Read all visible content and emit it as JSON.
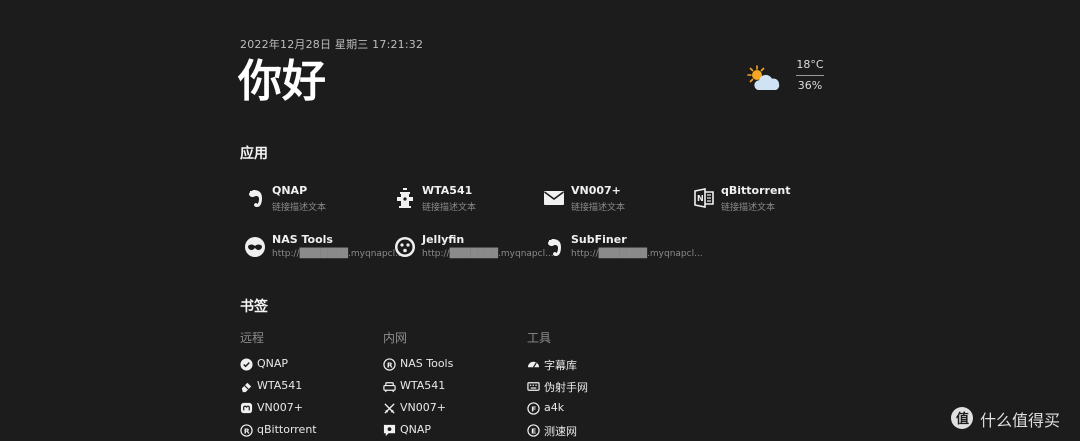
{
  "header": {
    "datetime": "2022年12月28日 星期三 17:21:32",
    "greeting": "你好"
  },
  "weather": {
    "icon": "partly-cloudy-icon",
    "temperature": "18°C",
    "humidity": "36%"
  },
  "apps": {
    "title": "应用",
    "items": [
      {
        "name": "QNAP",
        "desc": "链接描述文本",
        "icon": "evernote-icon"
      },
      {
        "name": "WTA541",
        "desc": "链接描述文本",
        "icon": "fire-hydrant-icon"
      },
      {
        "name": "VN007+",
        "desc": "链接描述文本",
        "icon": "mail-icon"
      },
      {
        "name": "qBittorrent",
        "desc": "链接描述文本",
        "icon": "office-icon"
      },
      {
        "name": "NAS Tools",
        "desc": "http://███████.myqnapcl...",
        "icon": "mask-icon"
      },
      {
        "name": "Jellyfin",
        "desc": "http://███████.myqnapcl...",
        "icon": "face-icon"
      },
      {
        "name": "SubFiner",
        "desc": "http://███████.myqnapcl...",
        "icon": "evernote-icon"
      }
    ]
  },
  "bookmarks": {
    "title": "书签",
    "columns": [
      {
        "heading": "远程",
        "items": [
          {
            "label": "QNAP",
            "icon": "check-badge-icon"
          },
          {
            "label": "WTA541",
            "icon": "eraser-icon"
          },
          {
            "label": "VN007+",
            "icon": "mastodon-icon"
          },
          {
            "label": "qBittorrent",
            "icon": "registered-icon"
          }
        ]
      },
      {
        "heading": "内网",
        "items": [
          {
            "label": "NAS Tools",
            "icon": "registered-icon"
          },
          {
            "label": "WTA541",
            "icon": "sofa-icon"
          },
          {
            "label": "VN007+",
            "icon": "swords-icon"
          },
          {
            "label": "QNAP",
            "icon": "message-icon"
          }
        ]
      },
      {
        "heading": "工具",
        "items": [
          {
            "label": "字幕库",
            "icon": "gauge-icon"
          },
          {
            "label": "伪射手网",
            "icon": "keyboard-icon"
          },
          {
            "label": "a4k",
            "icon": "circle-f-icon"
          },
          {
            "label": "测速网",
            "icon": "circle-e-icon"
          }
        ]
      }
    ]
  },
  "watermark": {
    "text": "什么值得买",
    "icon": "smzdm-logo-icon"
  }
}
